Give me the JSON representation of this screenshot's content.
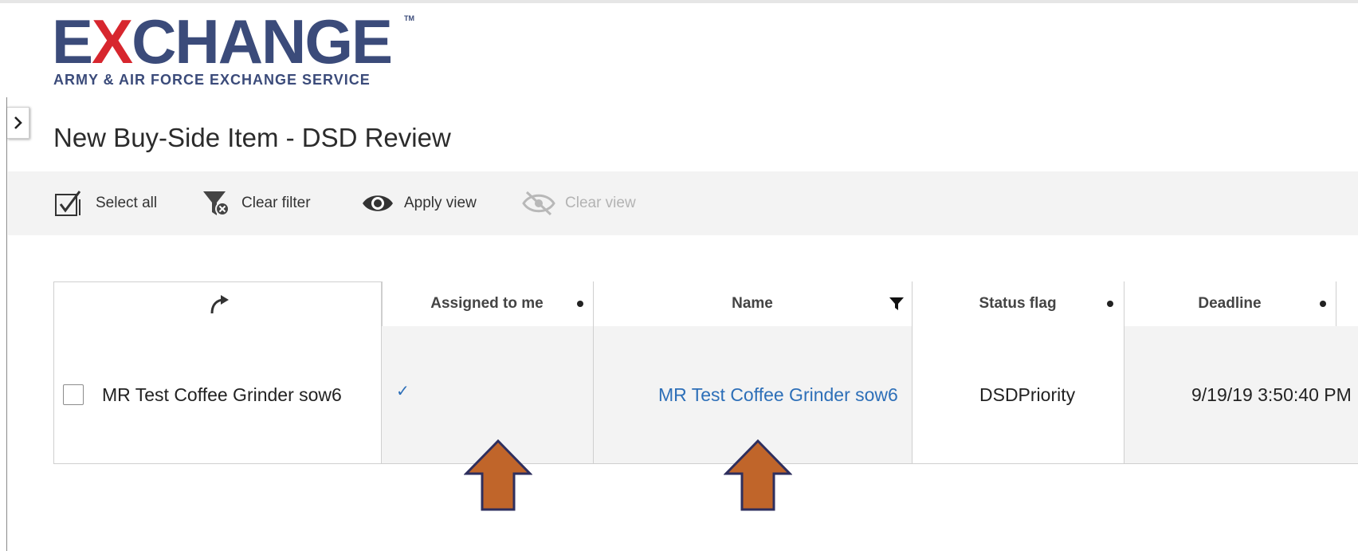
{
  "logo": {
    "word_prefix": "E",
    "word_x": "X",
    "word_rest": "CHANGE",
    "trademark": "TM",
    "subtitle": "ARMY & AIR FORCE EXCHANGE SERVICE"
  },
  "page": {
    "title": "New Buy-Side Item - DSD Review"
  },
  "toolbar": {
    "select_all": "Select all",
    "clear_filter": "Clear filter",
    "apply_view": "Apply view",
    "clear_view": "Clear view"
  },
  "grid": {
    "columns": [
      {
        "label": "Assigned to me"
      },
      {
        "label": "Name"
      },
      {
        "label": "Status flag"
      },
      {
        "label": "Deadline"
      }
    ],
    "rows": [
      {
        "title": "MR Test Coffee Grinder sow6",
        "assigned_to_me": "✓",
        "name": "MR Test Coffee Grinder sow6",
        "status_flag": "DSDPriority",
        "deadline": "9/19/19 3:50:40 PM"
      }
    ]
  },
  "colors": {
    "brand_blue": "#3b4b7a",
    "brand_red": "#d7262e",
    "link": "#2d6fb8",
    "annotation_arrow_fill": "#c0652a",
    "annotation_arrow_stroke": "#2e2f5e"
  }
}
